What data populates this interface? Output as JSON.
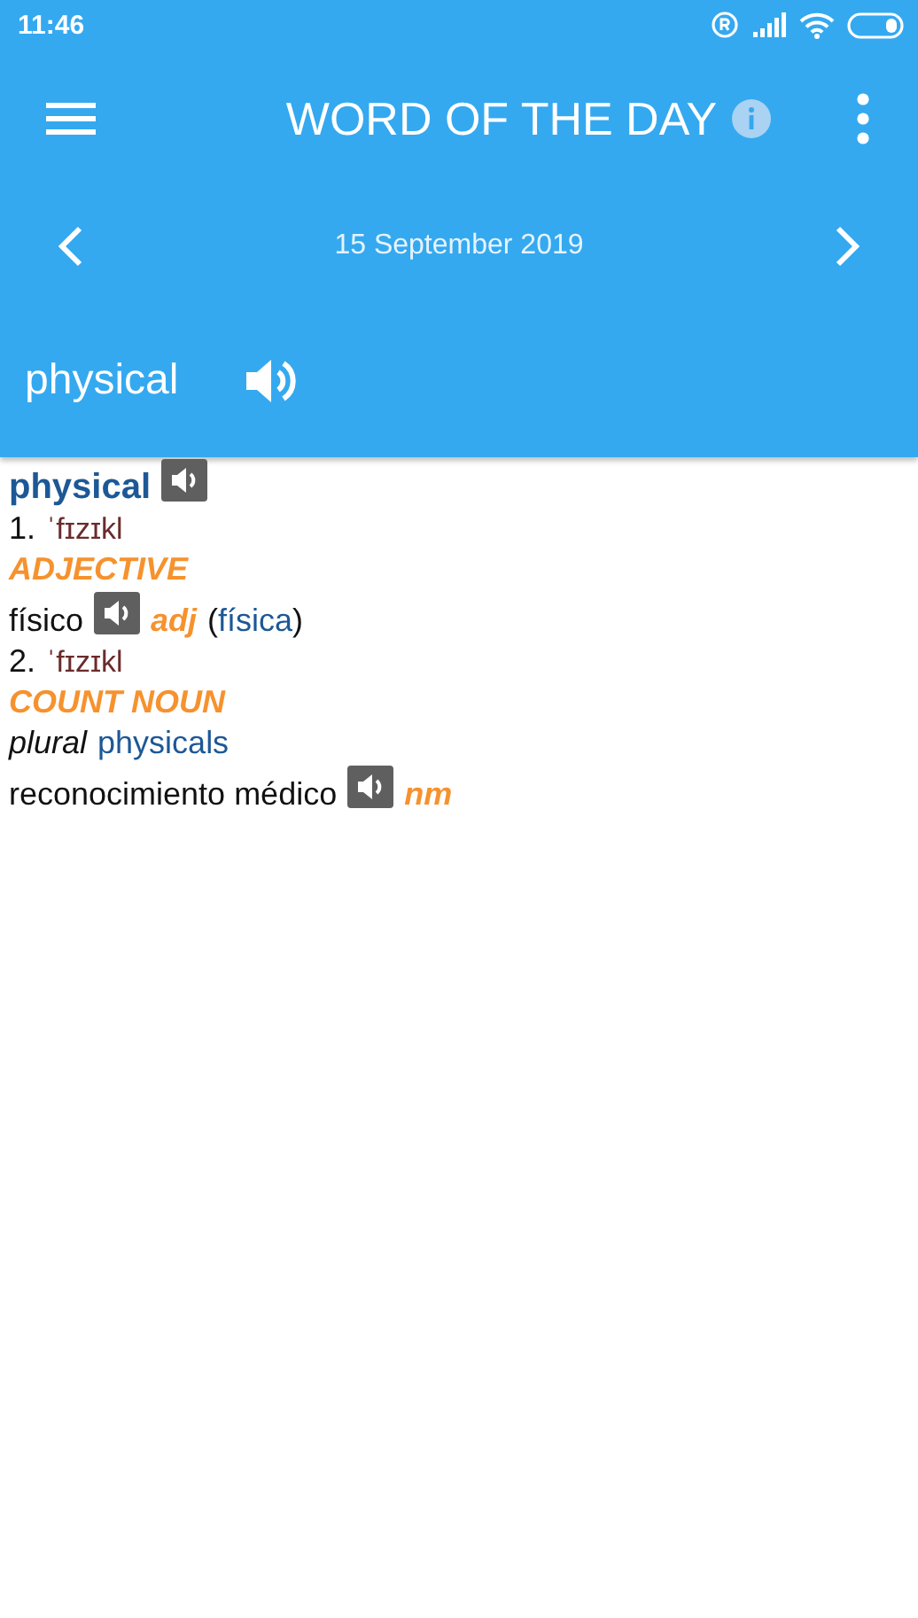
{
  "status_bar": {
    "time": "11:46"
  },
  "app_bar": {
    "title": "WORD OF THE DAY",
    "date": "15 September 2019",
    "word": "physical"
  },
  "lines": [
    {
      "parts": [
        {
          "kind": "headword",
          "text": "physical"
        },
        {
          "kind": "speaker"
        }
      ]
    },
    {
      "parts": [
        {
          "kind": "plain",
          "text": "1."
        },
        {
          "kind": "pron",
          "text": "ˈfɪzɪkl"
        }
      ]
    },
    {
      "parts": [
        {
          "kind": "pos",
          "text": "ADJECTIVE"
        }
      ]
    },
    {
      "parts": [
        {
          "kind": "plain",
          "text": "físico"
        },
        {
          "kind": "speaker"
        },
        {
          "kind": "abbr",
          "text": "adj"
        },
        {
          "kind": "open",
          "text": "("
        },
        {
          "kind": "link",
          "text": "física"
        },
        {
          "kind": "close",
          "text": ")"
        }
      ]
    },
    {
      "parts": [
        {
          "kind": "plain",
          "text": "2."
        },
        {
          "kind": "pron",
          "text": "ˈfɪzɪkl"
        }
      ]
    },
    {
      "parts": [
        {
          "kind": "pos",
          "text": "COUNT NOUN"
        }
      ]
    },
    {
      "parts": [
        {
          "kind": "italic",
          "text": "plural"
        },
        {
          "kind": "link",
          "text": "physicals"
        }
      ]
    },
    {
      "parts": [
        {
          "kind": "plain",
          "text": "reconocimiento médico"
        },
        {
          "kind": "speaker"
        },
        {
          "kind": "abbr",
          "text": "nm"
        }
      ]
    }
  ]
}
